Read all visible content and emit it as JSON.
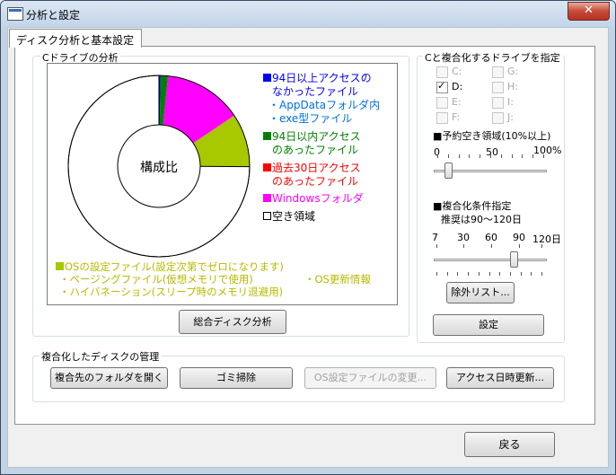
{
  "window": {
    "title": "分析と設定",
    "close_symbol": "✕"
  },
  "tab": {
    "label": "ディスク分析と基本設定"
  },
  "analysis": {
    "group_title": "Cドライブの分析",
    "center_label": "構成比",
    "button_label": "総合ディスク分析",
    "legend": {
      "l1": "94日以上アクセスの",
      "l2": "なかったファイル",
      "l3": "・AppDataフォルダ内",
      "l4": "・exe型ファイル",
      "l5": "94日以内アクセス",
      "l6": "のあったファイル",
      "l7": "過去30日アクセス",
      "l8": "のあったファイル",
      "l9": "Windowsフォルダ",
      "l10": "空き領域",
      "os1": "OSの設定ファイル(設定次第でゼロになります)",
      "os2": "・ページングファイル(仮想メモリで使用)",
      "os3": "・ハイバネーション(スリープ時のメモリ退避用)",
      "os4": "・OS更新情報"
    },
    "colors": {
      "blue": "#0000ff",
      "lightblue": "#0070e0",
      "green": "#008000",
      "red": "#ff0000",
      "magenta": "#ff00ff",
      "olive": "#a8c800",
      "yellowtext": "#b8b800",
      "freesq": "#ffffff"
    },
    "pie_fractions": {
      "blue": 0.003,
      "green": 0.013,
      "magenta": 0.14,
      "olive": 0.095,
      "free": 0.749
    }
  },
  "drives": {
    "group_title": "Cと複合化するドライブを指定",
    "list": [
      {
        "label": "C:",
        "checked": false,
        "enabled": false
      },
      {
        "label": "D:",
        "checked": true,
        "enabled": true
      },
      {
        "label": "E:",
        "checked": false,
        "enabled": false
      },
      {
        "label": "F:",
        "checked": false,
        "enabled": false
      },
      {
        "label": "G:",
        "checked": false,
        "enabled": false
      },
      {
        "label": "H:",
        "checked": false,
        "enabled": false
      },
      {
        "label": "I:",
        "checked": false,
        "enabled": false
      },
      {
        "label": "J:",
        "checked": false,
        "enabled": false
      }
    ],
    "check_mark": "✓",
    "reserve_title": "■予約空き領域(10%以上)",
    "reserve_ticks": {
      "t0": "0",
      "t50": "50",
      "t100": "100%"
    },
    "reserve_value_percent": 10,
    "cond_title": "■複合化条件指定",
    "cond_sub": "推奨は90～120日",
    "cond_ticks": {
      "t7": "7",
      "t30": "30",
      "t60": "60",
      "t90": "90",
      "t120": "120日"
    },
    "cond_value_days": 90,
    "exclude_button": "除外リスト...",
    "settings_button": "設定"
  },
  "manage": {
    "group_title": "複合化したディスクの管理",
    "b1": "複合先のフォルダを開く",
    "b2": "ゴミ掃除",
    "b3": "OS設定ファイルの変更...",
    "b4": "アクセス日時更新..."
  },
  "footer": {
    "back_button": "戻る"
  }
}
